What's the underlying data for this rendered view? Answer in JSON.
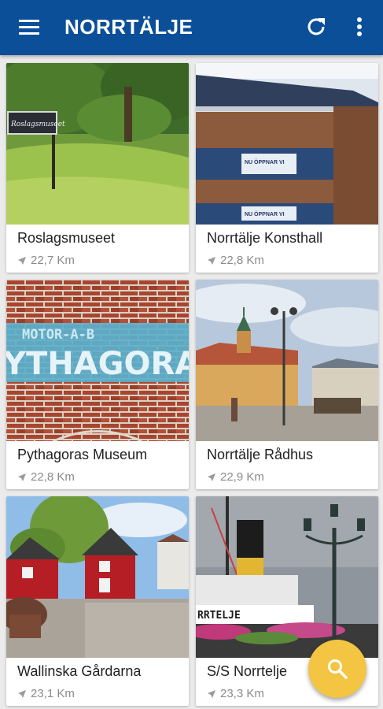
{
  "header": {
    "title": "NORRTÄLJE",
    "menu_icon": "hamburger-menu-icon",
    "refresh_icon": "refresh-icon",
    "more_icon": "more-vertical-icon",
    "background": "#0b4f99"
  },
  "places": [
    {
      "name": "Roslagsmuseet",
      "distance": "22,7 Km"
    },
    {
      "name": "Norrtälje Konsthall",
      "distance": "22,8 Km"
    },
    {
      "name": "Pythagoras Museum",
      "distance": "22,8 Km"
    },
    {
      "name": "Norrtälje Rådhus",
      "distance": "22,9 Km"
    },
    {
      "name": "Wallinska Gårdarna",
      "distance": "23,1 Km"
    },
    {
      "name": "S/S Norrtelje",
      "distance": "23,3 Km"
    }
  ],
  "photo_text": {
    "sign": "Roslagsmuseet",
    "konsthall_window_1": "NU ÖPPNAR VI",
    "konsthall_window_2": "NU ÖPPNAR VI",
    "pythagoras_top": "MOTOR-A-B",
    "pythagoras_main": "YTHAGORA",
    "ship_name": "RRTELJE"
  },
  "fab": {
    "icon": "search-icon",
    "color": "#f4c542"
  }
}
